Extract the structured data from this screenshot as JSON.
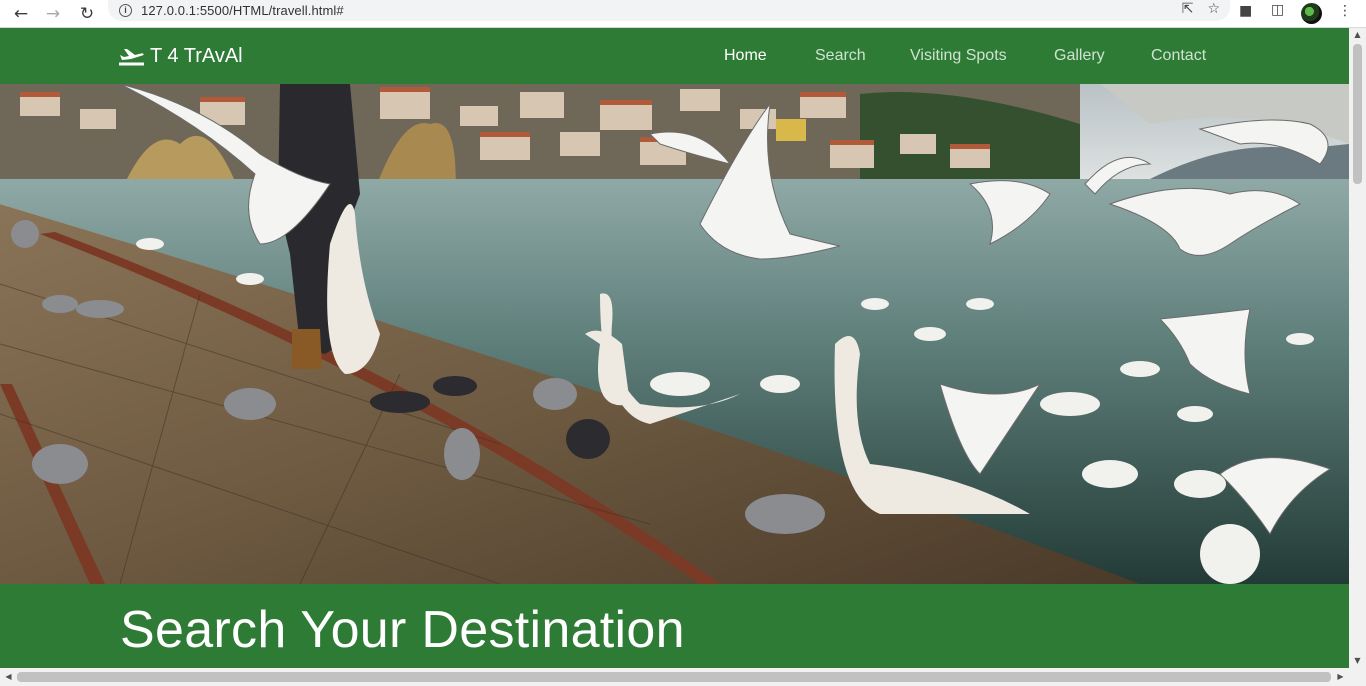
{
  "browser": {
    "url": "127.0.0.1:5500/HTML/travell.html#"
  },
  "brand": {
    "name": "T 4 TrAvAl",
    "icon": "airplane-departure-icon"
  },
  "nav": {
    "items": [
      {
        "label": "Home",
        "active": true
      },
      {
        "label": "Search",
        "active": false
      },
      {
        "label": "Visiting Spots",
        "active": false
      },
      {
        "label": "Gallery",
        "active": false
      },
      {
        "label": "Contact",
        "active": false
      }
    ]
  },
  "hero": {
    "image": "lakeside-birds-photo"
  },
  "search": {
    "title": "Search Your Destination"
  },
  "colors": {
    "header_bg": "#2e7b35",
    "nav_text": "#cfe3d0",
    "nav_active": "#ffffff"
  }
}
